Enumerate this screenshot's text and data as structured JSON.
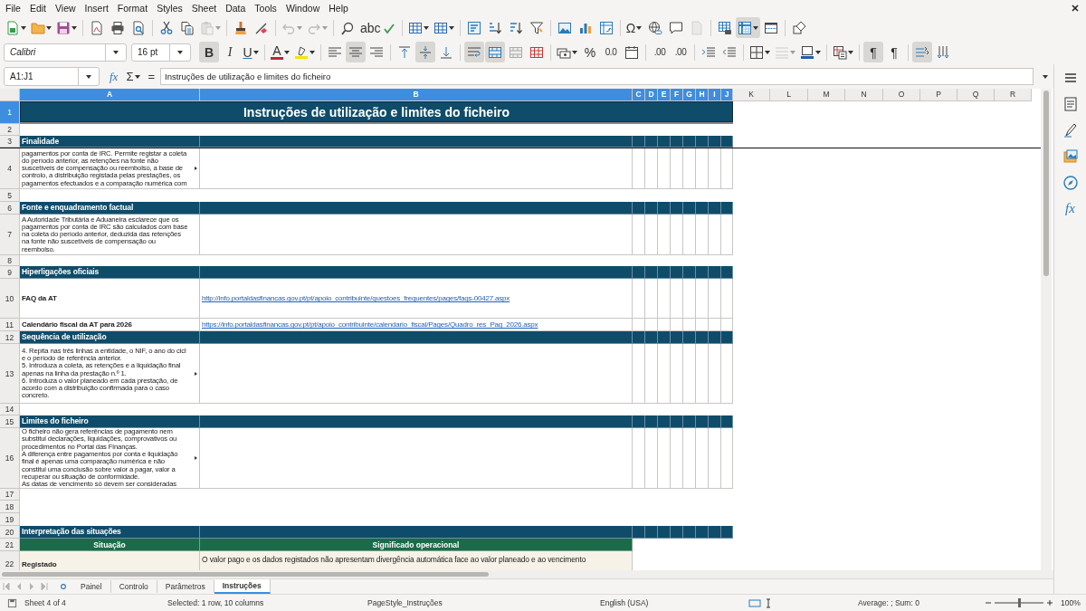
{
  "menu": [
    "File",
    "Edit",
    "View",
    "Insert",
    "Format",
    "Styles",
    "Sheet",
    "Data",
    "Tools",
    "Window",
    "Help"
  ],
  "standard_toolbar": [
    {
      "kind": "new",
      "dropdown": true,
      "on": false,
      "disabled": false
    },
    {
      "kind": "open",
      "dropdown": true,
      "on": false,
      "disabled": false
    },
    {
      "kind": "save",
      "dropdown": true,
      "on": false,
      "disabled": false
    },
    {
      "kind": "separator"
    },
    {
      "kind": "pdf",
      "dropdown": false,
      "on": false,
      "disabled": false
    },
    {
      "kind": "print",
      "dropdown": false,
      "on": false,
      "disabled": false
    },
    {
      "kind": "preview",
      "dropdown": false,
      "on": false,
      "disabled": false
    },
    {
      "kind": "separator"
    },
    {
      "kind": "cut",
      "dropdown": false,
      "on": false,
      "disabled": false
    },
    {
      "kind": "copy",
      "dropdown": false,
      "on": false,
      "disabled": false
    },
    {
      "kind": "paste",
      "dropdown": true,
      "on": false,
      "disabled": true
    },
    {
      "kind": "separator"
    },
    {
      "kind": "clone",
      "dropdown": false,
      "on": false,
      "disabled": false
    },
    {
      "kind": "clear",
      "dropdown": false,
      "on": false,
      "disabled": false
    },
    {
      "kind": "separator"
    },
    {
      "kind": "undo",
      "dropdown": true,
      "on": false,
      "disabled": true
    },
    {
      "kind": "redo",
      "dropdown": true,
      "on": false,
      "disabled": true
    },
    {
      "kind": "separator"
    },
    {
      "kind": "find",
      "dropdown": false,
      "on": false,
      "disabled": false
    },
    {
      "kind": "spelling",
      "glyph": "abc",
      "dropdown": false,
      "on": false,
      "disabled": false
    },
    {
      "kind": "separator"
    },
    {
      "kind": "row",
      "dropdown": true,
      "on": false,
      "disabled": false
    },
    {
      "kind": "column",
      "dropdown": true,
      "on": false,
      "disabled": false
    },
    {
      "kind": "separator"
    },
    {
      "kind": "sort",
      "dropdown": false,
      "on": false,
      "disabled": false
    },
    {
      "kind": "sortasc",
      "dropdown": false,
      "on": false,
      "disabled": false
    },
    {
      "kind": "sortdesc",
      "dropdown": false,
      "on": false,
      "disabled": false
    },
    {
      "kind": "filter",
      "dropdown": false,
      "on": false,
      "disabled": false
    },
    {
      "kind": "separator"
    },
    {
      "kind": "image",
      "dropdown": false,
      "on": false,
      "disabled": false
    },
    {
      "kind": "chart",
      "dropdown": false,
      "on": false,
      "disabled": false
    },
    {
      "kind": "pivot",
      "dropdown": false,
      "on": false,
      "disabled": false
    },
    {
      "kind": "separator"
    },
    {
      "kind": "special",
      "glyph": "Ω",
      "dropdown": true,
      "on": false,
      "disabled": false
    },
    {
      "kind": "hyperlink",
      "dropdown": false,
      "on": false,
      "disabled": false
    },
    {
      "kind": "comment",
      "dropdown": false,
      "on": false,
      "disabled": false
    },
    {
      "kind": "headerfooter",
      "dropdown": false,
      "on": false,
      "disabled": true
    },
    {
      "kind": "separator"
    },
    {
      "kind": "printarea",
      "dropdown": false,
      "on": false,
      "disabled": false
    },
    {
      "kind": "freeze",
      "dropdown": true,
      "on": true,
      "disabled": false
    },
    {
      "kind": "split",
      "dropdown": false,
      "on": false,
      "disabled": false
    },
    {
      "kind": "separator"
    },
    {
      "kind": "shapes",
      "dropdown": false,
      "on": false,
      "disabled": false
    }
  ],
  "font_name": "Calibri",
  "font_size": "16 pt",
  "format_toolbar": [
    {
      "kind": "bold",
      "glyph": "B",
      "dropdown": false,
      "on": true,
      "disabled": false
    },
    {
      "kind": "italic",
      "glyph": "I",
      "dropdown": false,
      "on": false,
      "disabled": false
    },
    {
      "kind": "underline",
      "glyph": "U",
      "dropdown": true,
      "on": false,
      "disabled": false
    },
    {
      "kind": "separator"
    },
    {
      "kind": "fontcolor",
      "glyph": "A",
      "dropdown": true,
      "on": false,
      "disabled": false
    },
    {
      "kind": "highlight",
      "dropdown": true,
      "on": false,
      "disabled": false
    },
    {
      "kind": "separator"
    },
    {
      "kind": "alignleft",
      "dropdown": false,
      "on": false,
      "disabled": false
    },
    {
      "kind": "aligncenter",
      "dropdown": false,
      "on": true,
      "disabled": false
    },
    {
      "kind": "alignright",
      "dropdown": false,
      "on": false,
      "disabled": false
    },
    {
      "kind": "separator"
    },
    {
      "kind": "aligntop",
      "dropdown": false,
      "on": false,
      "disabled": false
    },
    {
      "kind": "alignmiddle",
      "dropdown": false,
      "on": true,
      "disabled": false
    },
    {
      "kind": "alignbottom",
      "dropdown": false,
      "on": false,
      "disabled": false
    },
    {
      "kind": "separator"
    },
    {
      "kind": "wrap",
      "dropdown": false,
      "on": true,
      "disabled": false
    },
    {
      "kind": "mergecenter",
      "dropdown": false,
      "on": true,
      "disabled": false
    },
    {
      "kind": "merge",
      "dropdown": false,
      "on": false,
      "disabled": false
    },
    {
      "kind": "unmerge",
      "dropdown": false,
      "on": false,
      "disabled": false
    },
    {
      "kind": "separator"
    },
    {
      "kind": "currency",
      "dropdown": true,
      "on": false,
      "disabled": false
    },
    {
      "kind": "percent",
      "glyph": "%",
      "dropdown": false,
      "on": false,
      "disabled": false
    },
    {
      "kind": "decimal",
      "glyph": "0.0",
      "dropdown": false,
      "on": false,
      "disabled": false
    },
    {
      "kind": "date",
      "dropdown": false,
      "on": false,
      "disabled": false
    },
    {
      "kind": "separator"
    },
    {
      "kind": "adddecimal",
      "glyph": ".00",
      "dropdown": false,
      "on": false,
      "disabled": false
    },
    {
      "kind": "deldecimal",
      "glyph": ".00",
      "dropdown": false,
      "on": false,
      "disabled": false
    },
    {
      "kind": "separator"
    },
    {
      "kind": "indentinc",
      "dropdown": false,
      "on": false,
      "disabled": false
    },
    {
      "kind": "indentdec",
      "dropdown": false,
      "on": false,
      "disabled": false
    },
    {
      "kind": "separator"
    },
    {
      "kind": "borders",
      "dropdown": true,
      "on": false,
      "disabled": false
    },
    {
      "kind": "borderstyle",
      "dropdown": true,
      "on": false,
      "disabled": true
    },
    {
      "kind": "bordercolor",
      "dropdown": true,
      "on": false,
      "disabled": false
    },
    {
      "kind": "separator"
    },
    {
      "kind": "conditional",
      "dropdown": true,
      "on": false,
      "disabled": false
    },
    {
      "kind": "separator"
    },
    {
      "kind": "ltr",
      "glyph": "¶",
      "dropdown": false,
      "on": true,
      "disabled": false
    },
    {
      "kind": "rtl",
      "glyph": "¶",
      "dropdown": false,
      "on": false,
      "disabled": false
    },
    {
      "kind": "separator"
    },
    {
      "kind": "textdir",
      "dropdown": false,
      "on": true,
      "disabled": false
    },
    {
      "kind": "vertical",
      "dropdown": false,
      "on": false,
      "disabled": false
    }
  ],
  "formula_bar": {
    "name_box": "A1:J1",
    "function_glyph": "fx",
    "sum_glyph": "Σ",
    "equals_glyph": "=",
    "formula": "Instruções de utilização e limites do ficheiro"
  },
  "columns": [
    {
      "label": "A",
      "selected": true
    },
    {
      "label": "B",
      "selected": true
    },
    {
      "label": "C",
      "selected": true
    },
    {
      "label": "D",
      "selected": true
    },
    {
      "label": "E",
      "selected": true
    },
    {
      "label": "F",
      "selected": true
    },
    {
      "label": "G",
      "selected": true
    },
    {
      "label": "H",
      "selected": true
    },
    {
      "label": "I",
      "selected": true
    },
    {
      "label": "J",
      "selected": true
    },
    {
      "label": "K",
      "selected": false
    },
    {
      "label": "L",
      "selected": false
    },
    {
      "label": "M",
      "selected": false
    },
    {
      "label": "N",
      "selected": false
    },
    {
      "label": "O",
      "selected": false
    },
    {
      "label": "P",
      "selected": false
    },
    {
      "label": "Q",
      "selected": false
    },
    {
      "label": "R",
      "selected": false
    }
  ],
  "rows": [
    {
      "number": "1",
      "kind": "title",
      "selected": true,
      "freeze_below": false,
      "text": "Instruções de utilização e limites do ficheiro"
    },
    {
      "number": "2",
      "kind": "blank",
      "selected": false,
      "freeze_below": false
    },
    {
      "number": "3",
      "kind": "section",
      "selected": false,
      "freeze_below": true,
      "text": "Finalidade"
    },
    {
      "number": "4",
      "kind": "text",
      "selected": false,
      "freeze_below": false,
      "clipped": true,
      "text": "pagamentos por conta de IRC. Permite registar a coleta\ndo período anterior, as retenções na fonte não\nsuscetíveis de compensação ou reembolso, a base de\ncontrolo, a distribuição registada pelas prestações, os\npagamentos efectuados e a comparação numérica com"
    },
    {
      "number": "5",
      "kind": "blank",
      "selected": false,
      "freeze_below": false
    },
    {
      "number": "6",
      "kind": "section",
      "selected": false,
      "freeze_below": false,
      "text": "Fonte e enquadramento factual"
    },
    {
      "number": "7",
      "kind": "text",
      "selected": false,
      "freeze_below": false,
      "clipped": false,
      "text": "A Autoridade Tributária e Aduaneira esclarece que os\npagamentos por conta de IRC são calculados com base\nna coleta do período anterior, deduzida das retenções\nna fonte não suscetíveis de compensação ou\nreembolso."
    },
    {
      "number": "8",
      "kind": "blank",
      "selected": false,
      "freeze_below": false
    },
    {
      "number": "9",
      "kind": "section",
      "selected": false,
      "freeze_below": false,
      "text": "Hiperligações oficiais"
    },
    {
      "number": "10",
      "kind": "link",
      "selected": false,
      "freeze_below": false,
      "label": "FAQ da AT",
      "url": "http://info.portaldasfinancas.gov.pt/pt/apoio_contribuinte/questoes_frequentes/pages/faqs-00427.aspx"
    },
    {
      "number": "11",
      "kind": "link",
      "selected": false,
      "freeze_below": false,
      "label": "Calendário fiscal da AT para 2026",
      "url": "https://info.portaldasfinancas.gov.pt/pt/apoio_contribuinte/calendario_fiscal/Pages/Quadro_res_Pag_2026.aspx"
    },
    {
      "number": "12",
      "kind": "section",
      "selected": false,
      "freeze_below": false,
      "text": "Sequência de utilização"
    },
    {
      "number": "13",
      "kind": "text",
      "selected": false,
      "freeze_below": false,
      "clipped": true,
      "text": "4. Repita nas três linhas a entidade, o NIF, o ano do cicl\ne o período de referência anterior.\n5. Introduza a coleta, as retenções e a liquidação final\napenas na linha da prestação n.º 1.\n6. Introduza o valor planeado em cada prestação, de\nacordo com a distribuição confirmada para o caso\nconcreto."
    },
    {
      "number": "14",
      "kind": "blank",
      "selected": false,
      "freeze_below": false
    },
    {
      "number": "15",
      "kind": "section",
      "selected": false,
      "freeze_below": false,
      "text": "Limites do ficheiro"
    },
    {
      "number": "16",
      "kind": "text",
      "selected": false,
      "freeze_below": false,
      "clipped": true,
      "text": "O ficheiro não gera referências de pagamento nem\nsubstitui declarações, liquidações, comprovativos ou\nprocedimentos no Portal das Finanças.\nA diferença entre pagamentos por conta e liquidação\nfinal é apenas uma comparação numérica e não\nconstitui uma conclusão sobre valor a pagar, valor a\nrecuperar ou situação de conformidade.\nAs datas de vencimento só devem ser consideradas"
    },
    {
      "number": "17",
      "kind": "blank",
      "selected": false,
      "freeze_below": false
    },
    {
      "number": "18",
      "kind": "blank",
      "selected": false,
      "freeze_below": false
    },
    {
      "number": "19",
      "kind": "blank",
      "selected": false,
      "freeze_below": false
    },
    {
      "number": "20",
      "kind": "section",
      "selected": false,
      "freeze_below": false,
      "text": "Interpretação das situações"
    },
    {
      "number": "21",
      "kind": "header",
      "selected": false,
      "freeze_below": false,
      "cells": [
        "Situação",
        "Significado operacional"
      ]
    },
    {
      "number": "22",
      "kind": "entry",
      "selected": false,
      "freeze_below": false,
      "label": "Registado",
      "text": "O valor pago e os dados registados não apresentam divergência automática face ao valor planeado e ao vencimento"
    }
  ],
  "sidebar": [
    {
      "kind": "menu"
    },
    {
      "kind": "properties"
    },
    {
      "kind": "styles"
    },
    {
      "kind": "gallery"
    },
    {
      "kind": "navigator"
    },
    {
      "kind": "functions",
      "glyph": "fx"
    }
  ],
  "sheet_tabs": [
    {
      "label": "Painel",
      "selected": false
    },
    {
      "label": "Controlo",
      "selected": false
    },
    {
      "label": "Parâmetros",
      "selected": false
    },
    {
      "label": "Instruções",
      "selected": true
    }
  ],
  "status_bar": {
    "sheet": "Sheet 4 of 4",
    "selection": "Selected: 1 row, 10 columns",
    "page_style": "PageStyle_Instruções",
    "language": "English (USA)",
    "summary": "Average: ; Sum: 0",
    "zoom": {
      "level": 0.5
    },
    "zoom_percent": "100%"
  }
}
